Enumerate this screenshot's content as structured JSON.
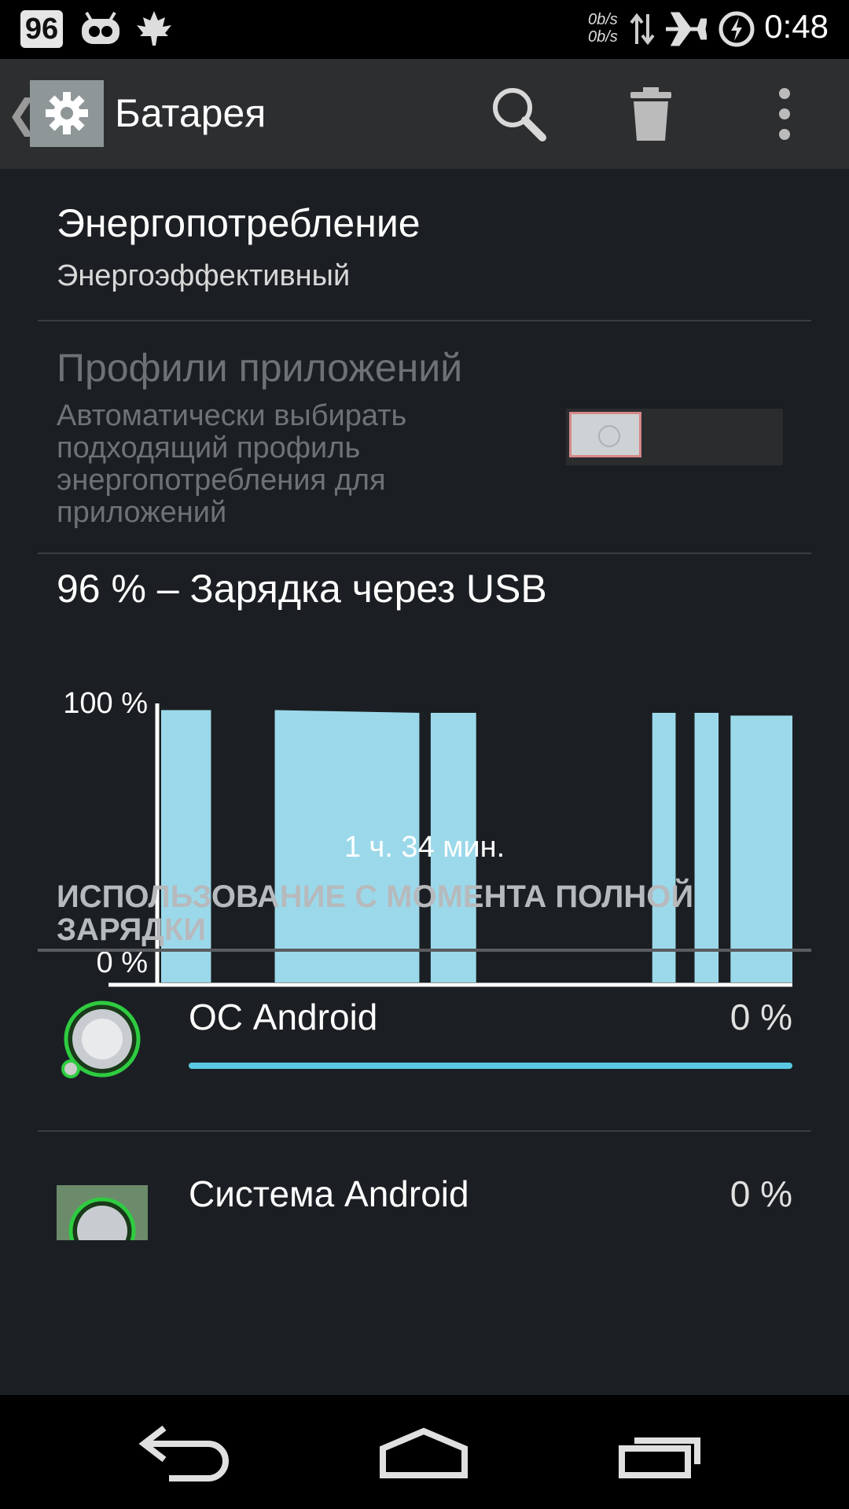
{
  "status_bar": {
    "battery_badge": "96",
    "net_up": "0b/s",
    "net_down": "0b/s",
    "time": "0:48"
  },
  "action_bar": {
    "title": "Батарея",
    "icons": [
      "back-chevron-icon",
      "settings-gear-icon",
      "search-icon",
      "trash-icon",
      "overflow-menu-icon"
    ]
  },
  "power_profile": {
    "title": "Энергопотребление",
    "summary": "Энергоэффективный"
  },
  "app_profiles": {
    "title": "Профили приложений",
    "description": "Автоматически выбирать подходящий профиль энергопотребления для приложений",
    "enabled": false
  },
  "battery_status": "96 % – Зарядка через USB",
  "chart_data": {
    "type": "area",
    "y_top_label": "100 %",
    "y_bottom_label": "0 %",
    "duration_label": "1 ч. 34 мин.",
    "ylim": [
      0,
      100
    ],
    "series": [
      {
        "segments": [
          {
            "start": 0.0,
            "end": 0.079,
            "level": [
              99,
              99
            ]
          },
          {
            "start": 0.18,
            "end": 0.409,
            "level": [
              99,
              98
            ]
          },
          {
            "start": 0.427,
            "end": 0.499,
            "level": [
              98,
              98
            ]
          },
          {
            "start": 0.778,
            "end": 0.815,
            "level": [
              98,
              98
            ]
          },
          {
            "start": 0.845,
            "end": 0.883,
            "level": [
              98,
              98
            ]
          },
          {
            "start": 0.902,
            "end": 1.0,
            "level": [
              97,
              97
            ]
          }
        ]
      }
    ]
  },
  "usage_section": {
    "header": "ИСПОЛЬЗОВАНИЕ С МОМЕНТА ПОЛНОЙ ЗАРЯДКИ",
    "apps": [
      {
        "name": "ОС Android",
        "percent": "0 %",
        "bar_fraction": 1.0,
        "icon": "android-os-knob-icon"
      },
      {
        "name": "Система Android",
        "percent": "0 %",
        "bar_fraction": 1.0,
        "icon": "android-system-knob-icon"
      }
    ]
  },
  "colors": {
    "chart_fill": "#9bd9ea",
    "accent": "#5ac8e4",
    "background": "#1b1f23"
  }
}
